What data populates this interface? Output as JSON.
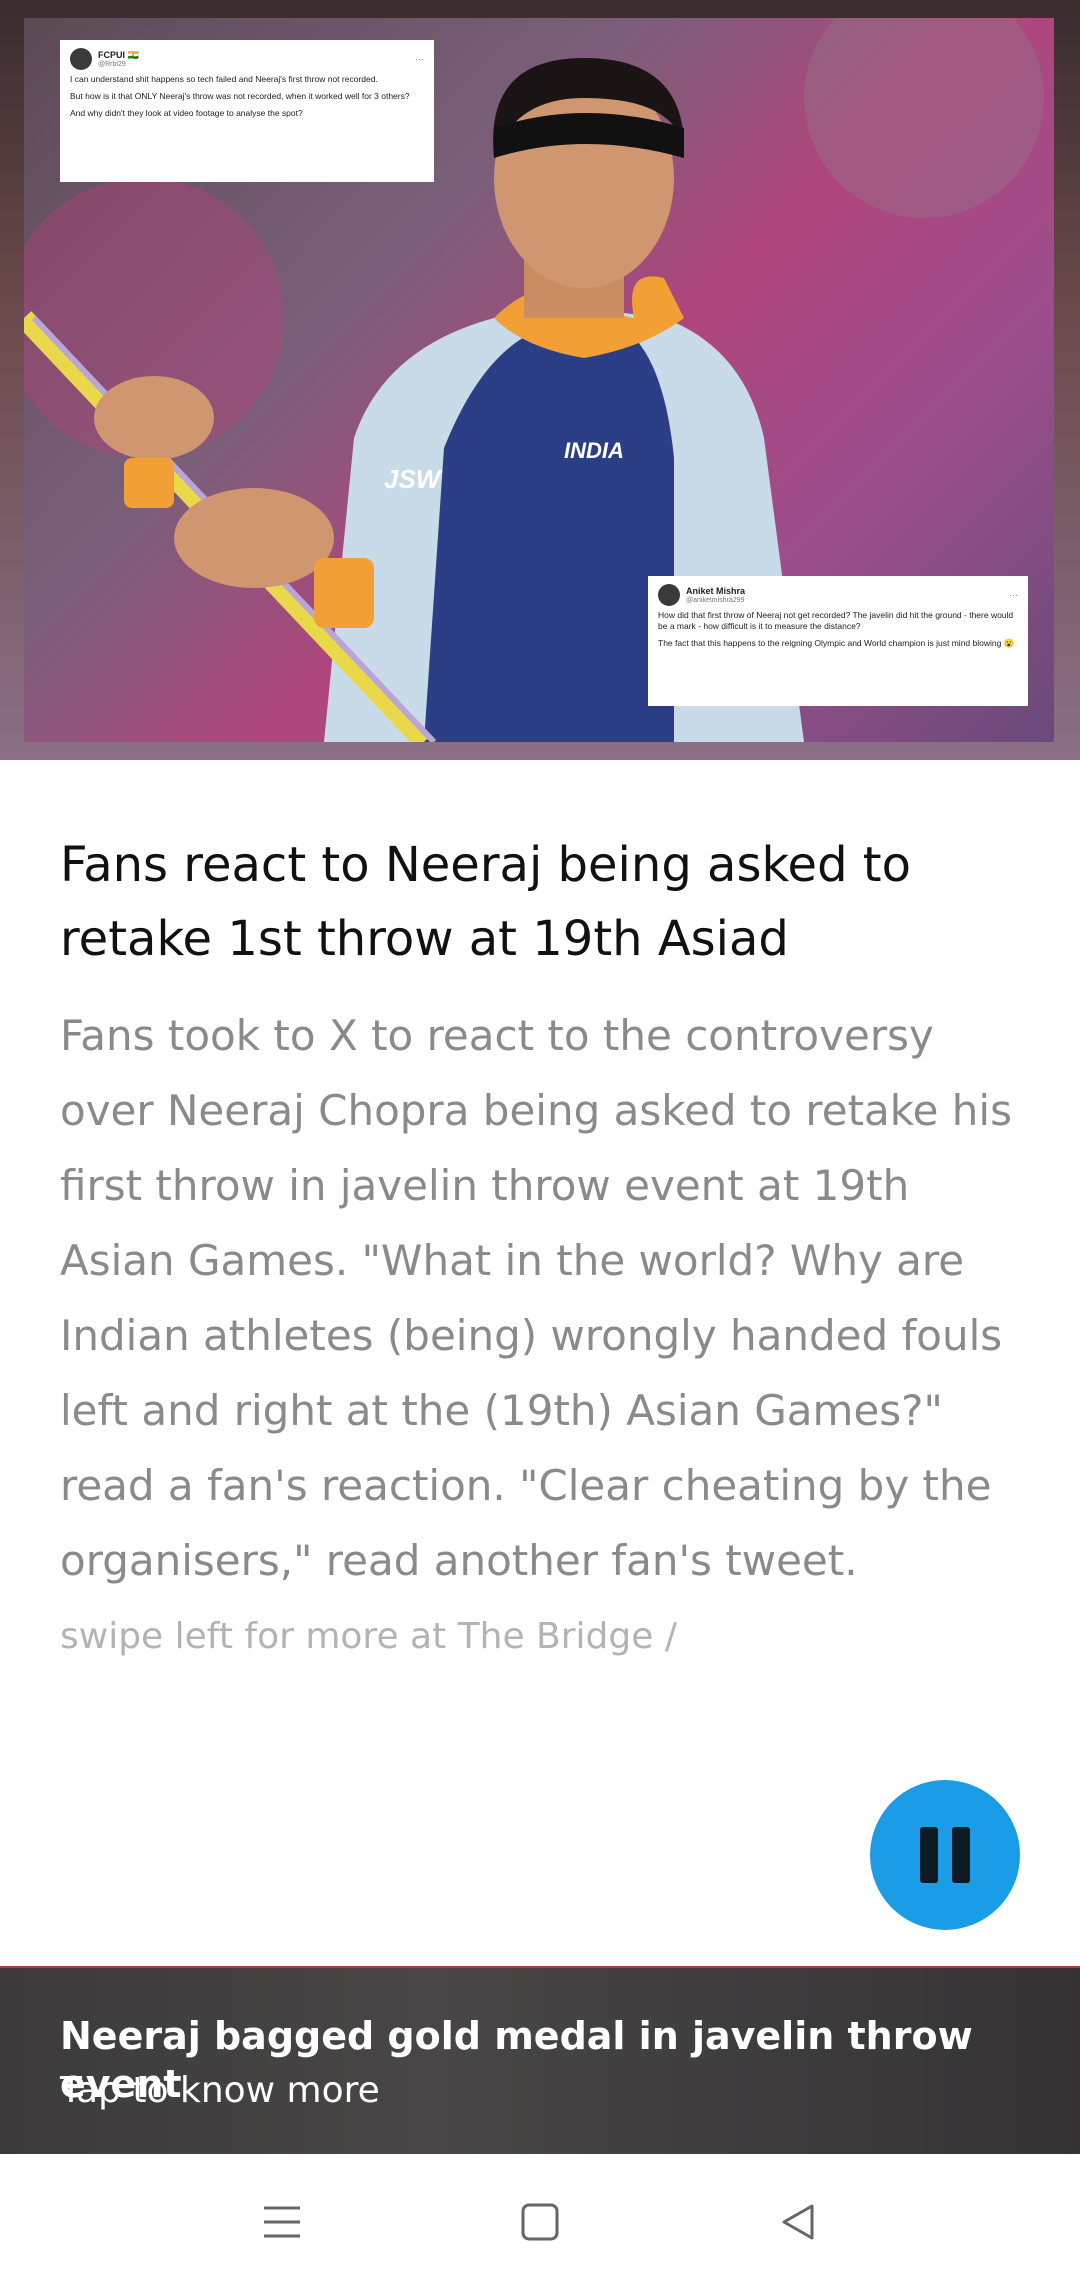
{
  "hero": {
    "image_alt": "Neeraj Chopra holding javelin",
    "tweet_1": {
      "name": "FCPUI 🇮🇳",
      "handle": "@Rrbl29",
      "lines": [
        "I can understand shit happens so tech failed and Neeraj's first throw not recorded.",
        "But how is it that ONLY Neeraj's throw was not recorded, when it worked well for 3 others?",
        "And why didn't they look at video footage to analyse the spot?"
      ]
    },
    "tweet_2": {
      "name": "Aniket Mishra",
      "handle": "@aniketmishra299",
      "lines": [
        "How did that first throw of Neeraj not get recorded? The javelin did hit the ground - there would be a mark - how difficult is it to measure the distance?",
        "The fact that this happens to the reigning Olympic and World champion is just mind blowing 😮"
      ]
    },
    "jacket_text": "INDIA",
    "sponsor_text": "JSW"
  },
  "article": {
    "title": "Fans react to Neeraj being asked to retake 1st throw at 19th Asiad",
    "body": "Fans took to X to react to the controversy over Neeraj Chopra being asked to retake his first throw in javelin throw event at 19th Asian Games. \"What in the world? Why are Indian athletes (being) wrongly handed fouls left and right at the (19th) Asian Games?\" read a fan's reaction. \"Clear cheating by the organisers,\" read another fan's tweet.",
    "swipe_text": "swipe left for more at The Bridge /"
  },
  "controls": {
    "pause_icon": "pause-icon",
    "accent_color": "#1a9ce6"
  },
  "promo": {
    "title": "Neeraj bagged gold medal in javelin throw event",
    "subtitle": "Tap to know more"
  },
  "navbar": {
    "menu_icon": "menu-icon",
    "home_icon": "home-icon",
    "back_icon": "back-icon"
  }
}
